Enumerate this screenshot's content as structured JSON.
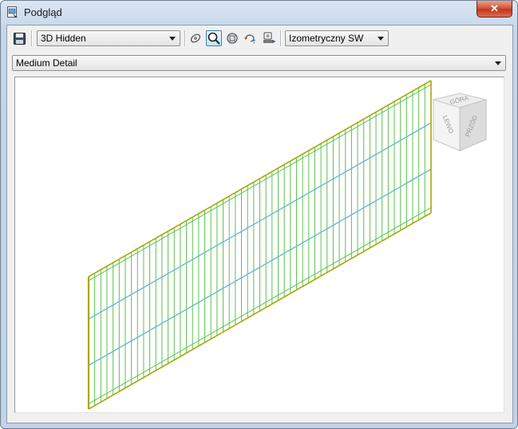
{
  "window": {
    "title": "Podgląd",
    "close_label": "✕"
  },
  "toolbar": {
    "visual_style": "3D Hidden",
    "view_direction": "Izometryczny SW",
    "detail_level": "Medium Detail"
  },
  "icons": {
    "save": "save-icon",
    "orbit": "orbit-icon",
    "zoom": "zoom-icon",
    "zoom_extents": "zoom-extents-icon",
    "rotate": "rotate-icon",
    "camera": "camera-icon"
  },
  "viewcube": {
    "top": "GÓRA",
    "left": "LEWO",
    "front": "PRZÓD"
  },
  "colors": {
    "mesh": "#5bc24f",
    "frame": "#a7a70a",
    "accent": "#6fb8c9"
  }
}
